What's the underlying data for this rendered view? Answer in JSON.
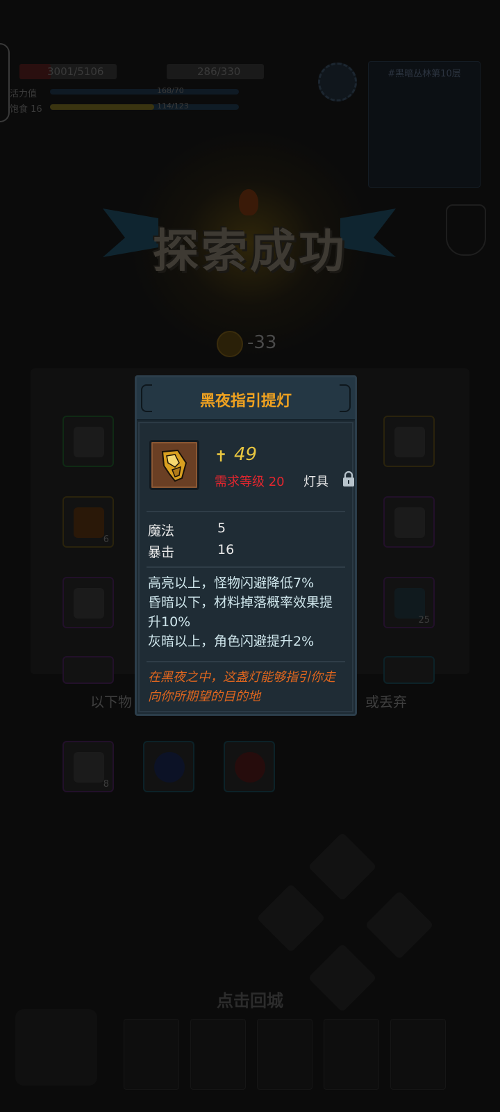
{
  "hud": {
    "hp": "3001/5106",
    "mp": "286/330",
    "stat1_label": "活力值",
    "stat1_value": "168/70",
    "stat2_label": "饱食 16",
    "stat2_value": "114/123",
    "map_title": "#黑暗丛林第10层"
  },
  "result": {
    "title": "探索成功",
    "coin_change": "-33"
  },
  "loot": {
    "left_slots": [
      {
        "count": ""
      },
      {
        "count": "6"
      },
      {
        "count": ""
      },
      {
        "count": ""
      }
    ],
    "right_slots": [
      {
        "count": ""
      },
      {
        "count": ""
      },
      {
        "count": "25"
      },
      {
        "count": ""
      }
    ],
    "hint_left": "以下物",
    "hint_right": "或丢弃",
    "bag_slots": [
      {
        "count": "8"
      },
      {
        "count": ""
      },
      {
        "count": ""
      }
    ],
    "return_label": "点击回城"
  },
  "tooltip": {
    "title": "黑夜指引提灯",
    "power_icon": "dagger-power-icon",
    "power": "49",
    "requirement": "需求等级 20",
    "item_type": "灯具",
    "stats": [
      {
        "name": "魔法",
        "value": "5"
      },
      {
        "name": "暴击",
        "value": "16"
      }
    ],
    "effects": [
      "高亮以上，怪物闪避降低7%",
      "昏暗以下，材料掉落概率效果提升10%",
      "灰暗以上，角色闪避提升2%"
    ],
    "flavor": "在黑夜之中，这盏灯能够指引你走向你所期望的目的地",
    "colors": {
      "title": "#f0a220",
      "requirement": "#e3262e",
      "power": "#e8c640",
      "flavor": "#e0661e"
    }
  }
}
